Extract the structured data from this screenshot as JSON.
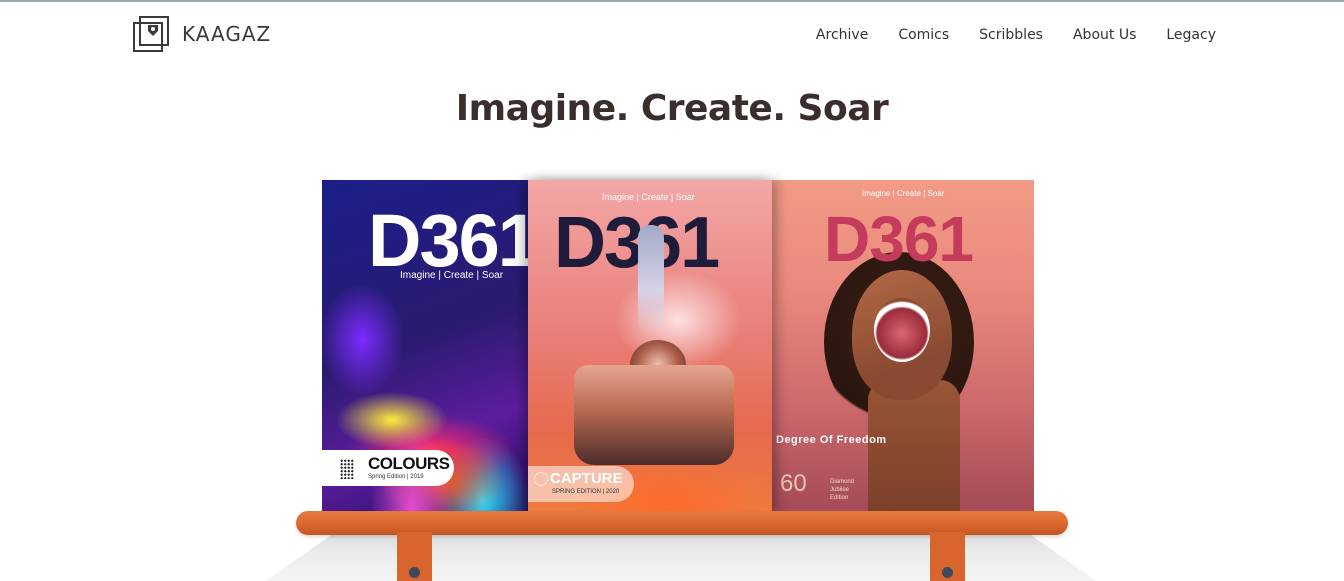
{
  "brand": {
    "name": "KAAGAZ"
  },
  "nav": {
    "items": [
      "Archive",
      "Comics",
      "Scribbles",
      "About Us",
      "Legacy"
    ]
  },
  "hero": {
    "headline": "Imagine. Create. Soar"
  },
  "covers": [
    {
      "mark": "D361",
      "tagline": "Imagine | Create | Soar",
      "title": "COLOURS",
      "edition": "Spring Edition | 2019"
    },
    {
      "mark": "D361",
      "tagline": "Imagine | Create | Soar",
      "title": "CAPTURE",
      "edition": "SPRING EDITION | 2020"
    },
    {
      "mark": "D361",
      "tagline": "Imagine | Create | Soar",
      "title": "Degree Of Freedom",
      "edition_line1": "Diamond",
      "edition_line2": "Jubilee",
      "edition_line3": "Edition",
      "emblem": "60"
    }
  ],
  "colors": {
    "shelf": "#d9652e",
    "headline": "#3a2e2c",
    "screw": "#3e4a5a"
  }
}
